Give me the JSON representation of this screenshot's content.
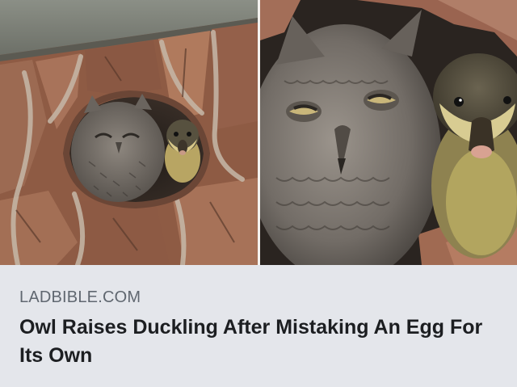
{
  "link_preview": {
    "source_domain": "LADBIBLE.COM",
    "headline": "Owl Raises Duckling After Mistaking An Egg For Its Own",
    "image_left": "owl-and-duckling-in-tree-hollow-photo",
    "image_right": "owl-and-duckling-closeup-photo"
  },
  "colors": {
    "caption_background": "#e4e6eb",
    "source_text": "#606770",
    "headline_text": "#1c1e21",
    "bark": "#8a5a44",
    "owl_gray": "#7c7670",
    "duckling_yellow": "#c9b56a"
  }
}
